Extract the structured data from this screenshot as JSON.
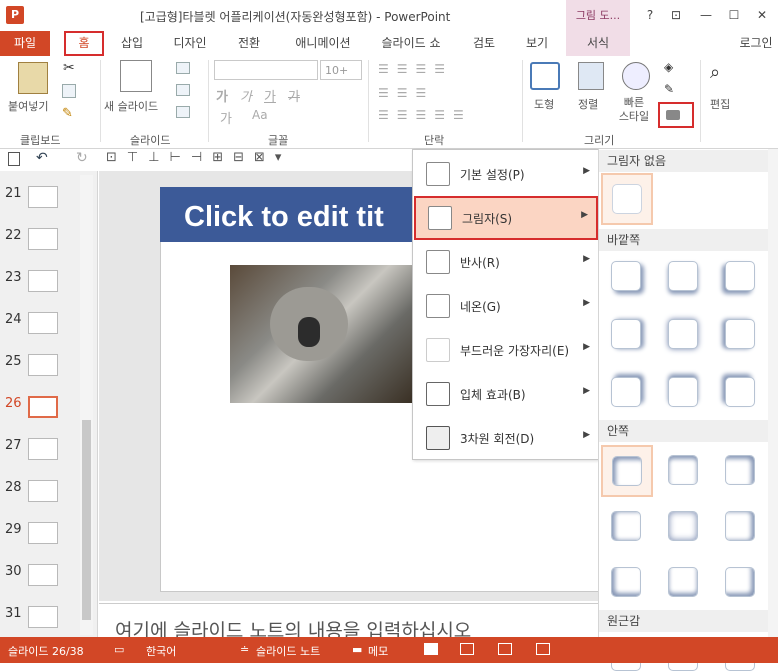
{
  "window": {
    "title": "[고급형]타블렛 어플리케이션(자동완성형포함) - PowerPoint",
    "context_tab_label": "그림 도...",
    "help_label": "?",
    "login_label": "로그인",
    "app_logo": "P"
  },
  "tabs": [
    {
      "label": "파일"
    },
    {
      "label": "홈"
    },
    {
      "label": "삽입"
    },
    {
      "label": "디자인"
    },
    {
      "label": "전환"
    },
    {
      "label": "애니메이션"
    },
    {
      "label": "슬라이드 쇼"
    },
    {
      "label": "검토"
    },
    {
      "label": "보기"
    },
    {
      "label": "서식"
    }
  ],
  "ribbon": {
    "paste_label": "붙여넣기",
    "new_slide_label": "새 슬라이드",
    "font_size_value": "10+",
    "shapes_label": "도형",
    "arrange_label": "정렬",
    "quick_styles_label": "빠른\n스타일",
    "edit_label": "편집",
    "groups": {
      "clipboard": "클립보드",
      "slides": "슬라이드",
      "font": "글꼴",
      "paragraph": "단락",
      "drawing": "그리기"
    }
  },
  "slides_panel": {
    "numbers": [
      "21",
      "22",
      "23",
      "24",
      "25",
      "26",
      "27",
      "28",
      "29",
      "30",
      "31"
    ],
    "selected": "26"
  },
  "slide": {
    "title": "Click to edit tit"
  },
  "notes": {
    "placeholder": "여기에 슬라이드 노트의 내용을 입력하십시오"
  },
  "menu": {
    "items": [
      {
        "label": "기본 설정(P)"
      },
      {
        "label": "그림자(S)"
      },
      {
        "label": "반사(R)"
      },
      {
        "label": "네온(G)"
      },
      {
        "label": "부드러운 가장자리(E)"
      },
      {
        "label": "입체 효과(B)"
      },
      {
        "label": "3차원 회전(D)"
      }
    ],
    "highlighted": "그림자(S)"
  },
  "gallery": {
    "sections": [
      {
        "label": "그림자 없음"
      },
      {
        "label": "바깥쪽"
      },
      {
        "label": "안쪽"
      },
      {
        "label": "원근감"
      }
    ]
  },
  "status": {
    "slide_counter": "슬라이드 26/38",
    "language": "한국어",
    "notes_label": "슬라이드 노트",
    "comments_label": "메모"
  },
  "colors": {
    "accent": "#d24726",
    "highlight": "#fbd5c3",
    "context": "#f1dde7",
    "slide_title_bg": "#3c5a98"
  }
}
